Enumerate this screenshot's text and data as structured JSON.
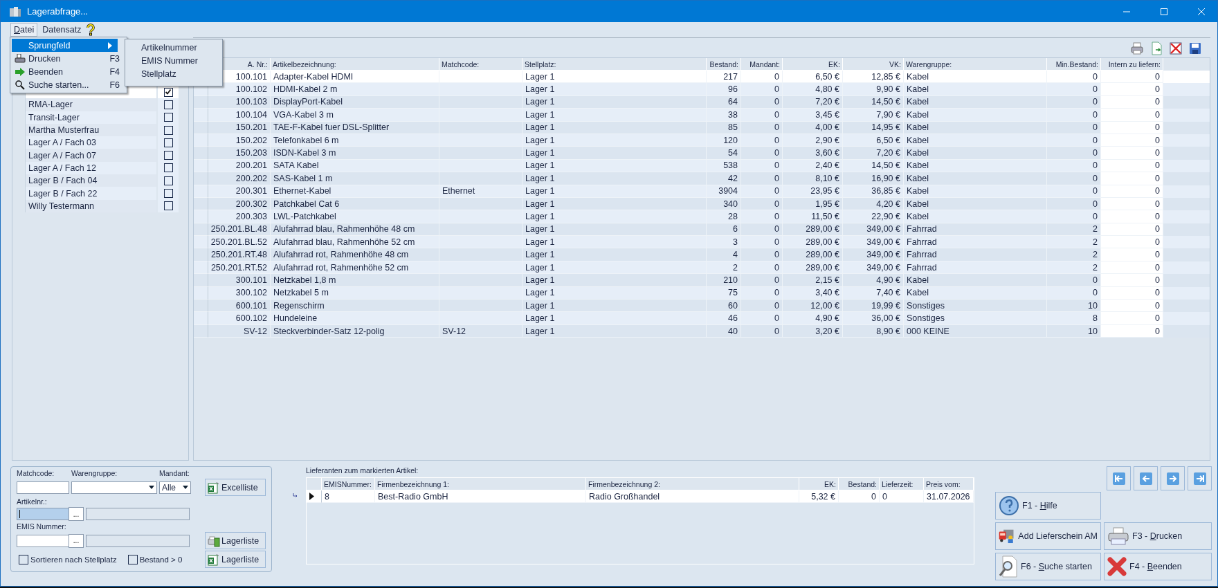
{
  "window": {
    "title": "Lagerabfrage..."
  },
  "menubar": [
    {
      "key": "D",
      "rest": "atei",
      "selected": true
    },
    {
      "rest": "Datensatz",
      "selected": false
    }
  ],
  "menu": [
    {
      "label": "Sprungfeld",
      "kind": "submenu",
      "selected": true
    },
    {
      "label": "Drucken",
      "shortcut": "F3",
      "kind": "print",
      "selected": false
    },
    {
      "label": "Beenden",
      "shortcut": "F4",
      "kind": "exit",
      "selected": false
    },
    {
      "label": "Suche starten...",
      "shortcut": "F6",
      "kind": "search",
      "selected": false
    }
  ],
  "submenu": [
    "Artikelnummer",
    "EMIS Nummer",
    "Stellplatz"
  ],
  "locations": [
    {
      "checked": true,
      "selected": true
    },
    {
      "label": "RMA-Lager",
      "checked": false,
      "selected": false
    },
    {
      "label": "Transit-Lager",
      "checked": false,
      "selected": false
    },
    {
      "label": "Martha Musterfrau",
      "checked": false,
      "selected": false
    },
    {
      "label": "Lager A / Fach 03",
      "checked": false,
      "selected": false
    },
    {
      "label": "Lager A / Fach 07",
      "checked": false,
      "selected": false
    },
    {
      "label": "Lager A / Fach 12",
      "checked": false,
      "selected": false
    },
    {
      "label": "Lager B / Fach 04",
      "checked": false,
      "selected": false
    },
    {
      "label": "Lager B / Fach 22",
      "checked": false,
      "selected": false
    },
    {
      "label": "Willy Testermann",
      "checked": false,
      "selected": false
    }
  ],
  "table": {
    "columns": [
      "A. Nr.:",
      "Artikelbezeichnung:",
      "Matchcode:",
      "Stellplatz:",
      "Bestand:",
      "Mandant:",
      "EK:",
      "VK:",
      "Warengruppe:",
      "Min.Bestand:",
      "Intern zu liefern:"
    ],
    "rows": [
      {
        "cells": [
          "100.101",
          "Adapter-Kabel HDMI",
          "",
          "Lager 1",
          "217",
          "0",
          "6,50 €",
          "12,85 €",
          "Kabel",
          "0",
          "0"
        ],
        "selected": true
      },
      {
        "cells": [
          "100.102",
          "HDMI-Kabel 2 m",
          "",
          "Lager 1",
          "96",
          "0",
          "4,80 €",
          "9,90 €",
          "Kabel",
          "0",
          "0"
        ],
        "selected": false
      },
      {
        "cells": [
          "100.103",
          "DisplayPort-Kabel",
          "",
          "Lager 1",
          "64",
          "0",
          "7,20 €",
          "14,50 €",
          "Kabel",
          "0",
          "0"
        ],
        "selected": false
      },
      {
        "cells": [
          "100.104",
          "VGA-Kabel 3 m",
          "",
          "Lager 1",
          "38",
          "0",
          "3,45 €",
          "7,90 €",
          "Kabel",
          "0",
          "0"
        ],
        "selected": false
      },
      {
        "cells": [
          "150.201",
          "TAE-F-Kabel fuer DSL-Splitter",
          "",
          "Lager 1",
          "85",
          "0",
          "4,00 €",
          "14,95 €",
          "Kabel",
          "0",
          "0"
        ],
        "selected": false
      },
      {
        "cells": [
          "150.202",
          "Telefonkabel 6 m",
          "",
          "Lager 1",
          "120",
          "0",
          "2,90 €",
          "6,50 €",
          "Kabel",
          "0",
          "0"
        ],
        "selected": false
      },
      {
        "cells": [
          "150.203",
          "ISDN-Kabel 3 m",
          "",
          "Lager 1",
          "54",
          "0",
          "3,60 €",
          "7,20 €",
          "Kabel",
          "0",
          "0"
        ],
        "selected": false
      },
      {
        "cells": [
          "200.201",
          "SATA Kabel",
          "",
          "Lager 1",
          "538",
          "0",
          "2,40 €",
          "14,50 €",
          "Kabel",
          "0",
          "0"
        ],
        "selected": false
      },
      {
        "cells": [
          "200.202",
          "SAS-Kabel 1 m",
          "",
          "Lager 1",
          "42",
          "0",
          "8,10 €",
          "16,90 €",
          "Kabel",
          "0",
          "0"
        ],
        "selected": false
      },
      {
        "cells": [
          "200.301",
          "Ethernet-Kabel",
          "Ethernet",
          "Lager 1",
          "3904",
          "0",
          "23,95 €",
          "36,85 €",
          "Kabel",
          "0",
          "0"
        ],
        "selected": false
      },
      {
        "cells": [
          "200.302",
          "Patchkabel Cat 6",
          "",
          "Lager 1",
          "340",
          "0",
          "1,95 €",
          "4,20 €",
          "Kabel",
          "0",
          "0"
        ],
        "selected": false
      },
      {
        "cells": [
          "200.303",
          "LWL-Patchkabel",
          "",
          "Lager 1",
          "28",
          "0",
          "11,50 €",
          "22,90 €",
          "Kabel",
          "0",
          "0"
        ],
        "selected": false
      },
      {
        "cells": [
          "250.201.BL.48",
          "Alufahrrad blau, Rahmenhöhe 48 cm",
          "",
          "Lager 1",
          "6",
          "0",
          "289,00 €",
          "349,00 €",
          "Fahrrad",
          "2",
          "0"
        ],
        "selected": false
      },
      {
        "cells": [
          "250.201.BL.52",
          "Alufahrrad blau, Rahmenhöhe 52 cm",
          "",
          "Lager 1",
          "3",
          "0",
          "289,00 €",
          "349,00 €",
          "Fahrrad",
          "2",
          "0"
        ],
        "selected": false
      },
      {
        "cells": [
          "250.201.RT.48",
          "Alufahrrad rot, Rahmenhöhe 48 cm",
          "",
          "Lager 1",
          "4",
          "0",
          "289,00 €",
          "349,00 €",
          "Fahrrad",
          "2",
          "0"
        ],
        "selected": false
      },
      {
        "cells": [
          "250.201.RT.52",
          "Alufahrrad rot, Rahmenhöhe 52 cm",
          "",
          "Lager 1",
          "2",
          "0",
          "289,00 €",
          "349,00 €",
          "Fahrrad",
          "2",
          "0"
        ],
        "selected": false
      },
      {
        "cells": [
          "300.101",
          "Netzkabel 1,8 m",
          "",
          "Lager 1",
          "210",
          "0",
          "2,15 €",
          "4,90 €",
          "Kabel",
          "0",
          "0"
        ],
        "selected": false
      },
      {
        "cells": [
          "300.102",
          "Netzkabel 5 m",
          "",
          "Lager 1",
          "75",
          "0",
          "3,40 €",
          "7,40 €",
          "Kabel",
          "0",
          "0"
        ],
        "selected": false
      },
      {
        "cells": [
          "600.101",
          "Regenschirm",
          "",
          "Lager 1",
          "60",
          "0",
          "12,00 €",
          "19,99 €",
          "Sonstiges",
          "10",
          "0"
        ],
        "selected": false
      },
      {
        "cells": [
          "600.102",
          "Hundeleine",
          "",
          "Lager 1",
          "46",
          "0",
          "4,90 €",
          "36,00 €",
          "Sonstiges",
          "8",
          "0"
        ],
        "selected": false
      },
      {
        "cells": [
          "SV-12",
          "Steckverbinder-Satz 12-polig",
          "SV-12",
          "Lager 1",
          "40",
          "0",
          "3,20 €",
          "8,90 €",
          "000 KEINE",
          "10",
          "0"
        ],
        "selected": false
      }
    ]
  },
  "filters": {
    "matchcode_label": "Matchcode:",
    "warengruppe_label": "Warengruppe:",
    "mandant_label": "Mandant:",
    "mandant_value": "Alle",
    "artikelnr_label": "Artikelnr.:",
    "artikelnr_focused": true,
    "emis_label": "EMIS Nummer:",
    "browse": "...",
    "checkboxes": [
      {
        "label": "Sortieren nach Stellplatz",
        "checked": false
      },
      {
        "label": "Bestand > 0",
        "checked": false
      }
    ],
    "buttons": [
      {
        "label": "Excelliste",
        "kind": "excel"
      },
      {
        "label": "Lagerliste",
        "kind": "print"
      },
      {
        "label": "Lagerliste",
        "kind": "excel"
      }
    ]
  },
  "suppliers": {
    "title": "Lieferanten zum markierten Artikel:",
    "columns": [
      "EMISNummer:",
      "Firmenbezeichnung 1:",
      "Firmenbezeichnung 2:",
      "EK:",
      "Bestand:",
      "Lieferzeit:",
      "Preis vom:"
    ],
    "rows": [
      {
        "cells": [
          "8",
          "Best-Radio GmbH",
          "Radio Großhandel",
          "5,32 €",
          "0",
          "0",
          "31.07.2026"
        ],
        "selected": true
      }
    ]
  },
  "actions": [
    {
      "prefix": "F1 - ",
      "key": "H",
      "rest": "ilfe",
      "kind": "help"
    },
    {
      "rest": "Add Lieferschein AM",
      "kind": "delivery"
    },
    {
      "prefix": "F3 - ",
      "key": "D",
      "rest": "rucken",
      "kind": "print"
    },
    {
      "prefix": "F6 - ",
      "key": "S",
      "rest": "uche starten",
      "kind": "search"
    },
    {
      "prefix": "F4 - ",
      "key": "B",
      "rest": "eenden",
      "kind": "exit"
    }
  ]
}
